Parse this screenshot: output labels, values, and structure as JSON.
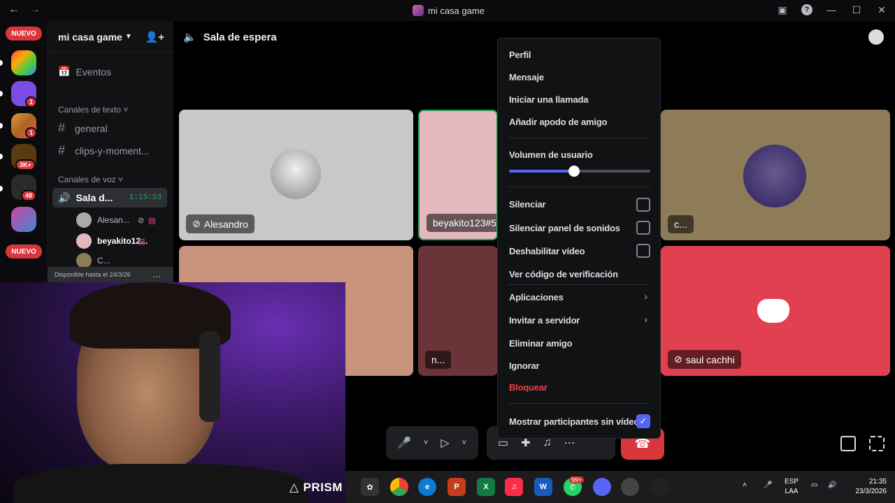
{
  "window": {
    "title": "mi casa game"
  },
  "rail": {
    "new_label": "NUEVO",
    "badges": [
      "1",
      "1",
      "3K+",
      "48"
    ]
  },
  "sidebar": {
    "server_name": "mi casa game",
    "events_label": "Eventos",
    "text_category": "Canales de texto",
    "text_channels": [
      "general",
      "clips-y-moment..."
    ],
    "voice_category": "Canales de voz",
    "voice_channel": {
      "name": "Sala d...",
      "timer": "1:15:53"
    },
    "voice_users": [
      "Alesan...",
      "beyakito12...",
      "C..."
    ],
    "promo_text": "Disponible hasta el 24/3/26",
    "promo_dots": "..."
  },
  "room": {
    "title": "Sala de espera"
  },
  "tiles": [
    {
      "label": "Alesandro",
      "bg": "#c8c8c6"
    },
    {
      "label": "beyakito123#52",
      "bg": "#e4b8bd"
    },
    {
      "label": "c...",
      "bg": "#8e7b58"
    },
    {
      "label": "",
      "bg": "#c8937c"
    },
    {
      "label": "n...",
      "bg": "#6a3438"
    },
    {
      "label": "saul cachhi",
      "bg": "#e04050"
    }
  ],
  "menu": {
    "items_top": [
      "Perfil",
      "Mensaje",
      "Iniciar una llamada",
      "Añadir apodo de amigo"
    ],
    "volume_label": "Volumen de usuario",
    "volume_value": 0.46,
    "checks": [
      {
        "label": "Silenciar",
        "checked": false
      },
      {
        "label": "Silenciar panel de sonidos",
        "checked": false
      },
      {
        "label": "Deshabilitar vídeo",
        "checked": false
      }
    ],
    "verify": "Ver código de verificación",
    "apps": "Aplicaciones",
    "invite": "Invitar a servidor",
    "remove": "Eliminar amigo",
    "ignore": "Ignorar",
    "block": "Bloquear",
    "show_no_video": "Mostrar participantes sin vídeo"
  },
  "taskbar": {
    "prism": "PRISM",
    "whatsapp_badge": "99+",
    "lang_top": "ESP",
    "lang_bottom": "LAA",
    "time": "21:35",
    "date": "23/3/2026"
  }
}
